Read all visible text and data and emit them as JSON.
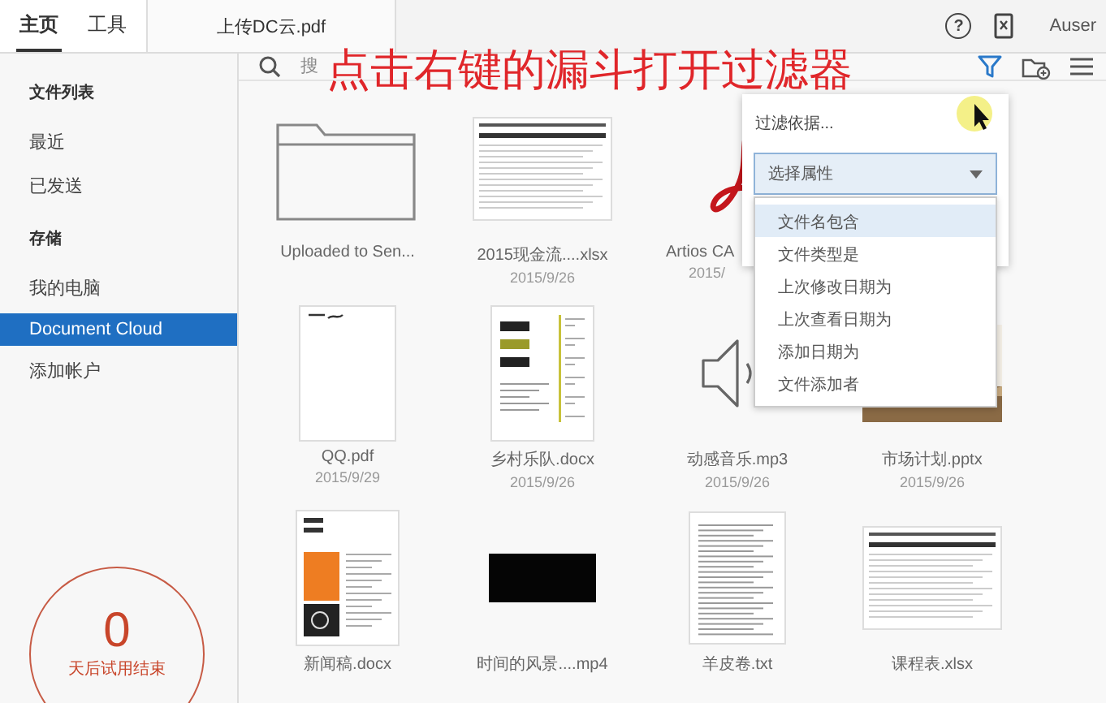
{
  "top_tabs": [
    {
      "label": "主页",
      "selected": true
    },
    {
      "label": "工具",
      "selected": false
    }
  ],
  "document_tab": {
    "title": "上传DC云.pdf"
  },
  "help": "?",
  "user": "Auser",
  "sidebar": {
    "sections": [
      {
        "heading": "文件列表",
        "items": [
          {
            "label": "最近",
            "selected": false
          },
          {
            "label": "已发送",
            "selected": false
          }
        ]
      },
      {
        "heading": "存储",
        "items": [
          {
            "label": "我的电脑",
            "selected": false
          },
          {
            "label": "Document Cloud",
            "selected": true
          },
          {
            "label": "添加帐户",
            "selected": false
          }
        ]
      }
    ]
  },
  "trial": {
    "days": "0",
    "caption": "天后试用结束"
  },
  "search": {
    "placeholder": "搜"
  },
  "annotation": "点击右键的漏斗打开过滤器",
  "files": [
    {
      "kind": "folder",
      "name": "Uploaded to Sen..."
    },
    {
      "kind": "sheet",
      "name": "2015现金流....xlsx",
      "date": "2015/9/26"
    },
    {
      "kind": "pdf",
      "name": "Artios CA",
      "date": "2015/"
    },
    {
      "kind": "page",
      "name": "QQ.pdf",
      "date": "2015/9/29"
    },
    {
      "kind": "poster",
      "name": "乡村乐队.docx",
      "date": "2015/9/26"
    },
    {
      "kind": "audio",
      "name": "动感音乐.mp3",
      "date": "2015/9/26"
    },
    {
      "kind": "slides",
      "name": "市场计划.pptx",
      "date": "2015/9/26"
    },
    {
      "kind": "newsletter",
      "name": "新闻稿.docx"
    },
    {
      "kind": "video",
      "name": "时间的风景....mp4"
    },
    {
      "kind": "text",
      "name": "羊皮卷.txt"
    },
    {
      "kind": "sheet",
      "name": "课程表.xlsx"
    }
  ],
  "filter_popover": {
    "title": "过滤依据...",
    "select": {
      "value": "选择属性",
      "expanded": true
    },
    "options": [
      {
        "label": "文件名包含",
        "selected": true
      },
      {
        "label": "文件类型是",
        "selected": false
      },
      {
        "label": "上次修改日期为",
        "selected": false
      },
      {
        "label": "上次查看日期为",
        "selected": false
      },
      {
        "label": "添加日期为",
        "selected": false
      },
      {
        "label": "文件添加者",
        "selected": false
      }
    ]
  }
}
